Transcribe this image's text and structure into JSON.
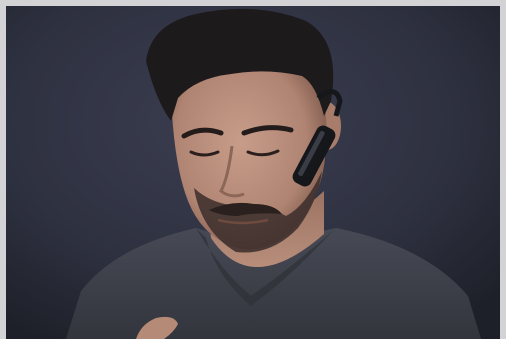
{
  "photo": {
    "subject": "man-with-bluetooth-headset",
    "colors": {
      "backdrop": "#2e3140",
      "backdrop_edge": "#1e2029",
      "frame": "#d3d3d6",
      "skin": "#b98f7c",
      "skin_shadow": "#8c6657",
      "hair": "#1d1a1c",
      "beard": "#3a2d2a",
      "shirt": "#3e4049",
      "headset": "#15171b"
    }
  }
}
